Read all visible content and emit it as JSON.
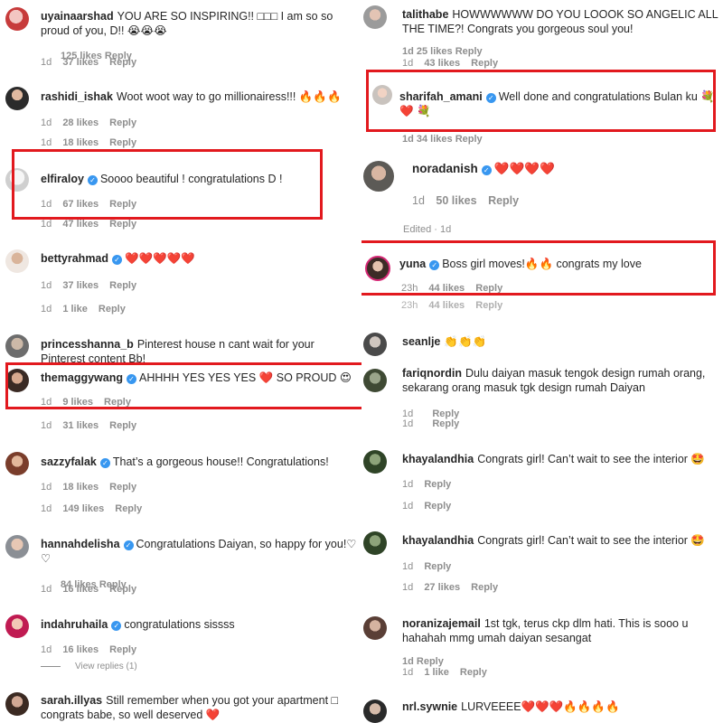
{
  "labels": {
    "likes_suffix": "likes",
    "like_suffix": "like",
    "reply": "Reply",
    "verified_mark": "✓"
  },
  "left": [
    {
      "user": "uyainaarshad",
      "verified": false,
      "text": "YOU ARE SO INSPIRING!! □□□ I am so so proud of you, D!! 😭😭😭",
      "time": "1d",
      "likes": "37 likes",
      "reply": "Reply",
      "ghost": "125 likes  Reply"
    },
    {
      "user": "rashidi_ishak",
      "verified": false,
      "text": "Woot woot way to go millionairess!!! 🔥🔥🔥",
      "time": "1d",
      "likes": "28 likes",
      "reply": "Reply",
      "ghost2_time": "1d",
      "ghost2_likes": "18 likes",
      "ghost2_reply": "Reply"
    },
    {
      "user": "elfiraloy",
      "verified": true,
      "text": "Soooo beautiful ! congratulations D !",
      "time": "1d",
      "likes": "67 likes",
      "reply": "Reply",
      "ghost2_time": "1d",
      "ghost2_likes": "47 likes",
      "ghost2_reply": "Reply"
    },
    {
      "user": "bettyrahmad",
      "verified": true,
      "text": "❤️❤️❤️❤️❤️",
      "time": "1d",
      "likes": "37 likes",
      "reply": "Reply",
      "ghost2_time": "1d",
      "ghost2_likes": "1 like",
      "ghost2_reply": "Reply"
    },
    {
      "user": "princesshanna_b",
      "verified": false,
      "text": "Pinterest house n cant wait for your Pinterest content Bb!"
    },
    {
      "user": "themaggywang",
      "verified": true,
      "text": "AHHHH YES YES YES ❤️ SO PROUD 😍",
      "time": "1d",
      "likes": "9 likes",
      "reply": "Reply",
      "ghost2_time": "1d",
      "ghost2_likes": "31 likes",
      "ghost2_reply": "Reply"
    },
    {
      "user": "sazzyfalak",
      "verified": true,
      "text": "That’s a gorgeous house!! Congratulations!",
      "time": "1d",
      "likes": "18 likes",
      "reply": "Reply",
      "ghost2_time": "1d",
      "ghost2_likes": "149 likes",
      "ghost2_reply": "Reply"
    },
    {
      "user": "hannahdelisha",
      "verified": true,
      "text": "Congratulations Daiyan, so happy for you!♡ ♡",
      "time": "1d",
      "likes": "16 likes",
      "reply": "Reply",
      "ghost": "84 likes  Reply"
    },
    {
      "user": "indahruhaila",
      "verified": true,
      "text": "congratulations sissss",
      "time": "1d",
      "likes": "16 likes",
      "reply": "Reply",
      "view_replies": "View replies (1)"
    },
    {
      "user": "sarah.illyas",
      "verified": false,
      "text": "Still remember when you got your apartment □ congrats babe, so well deserved ❤️"
    }
  ],
  "right": [
    {
      "user": "talithabe",
      "verified": false,
      "text": "HOWWWWWW DO YOU LOOOK SO ANGELIC ALL THE TIME?! Congrats you gorgeous soul you!",
      "time": "1d",
      "likes": "43 likes",
      "reply": "Reply",
      "ghost": "1d   25 likes  Reply"
    },
    {
      "user": "sharifah_amani",
      "verified": true,
      "text": "Well done and congratulations Bulan ku 💐 ❤️ 💐",
      "ghost": "1d   34 likes  Reply"
    },
    {
      "user": "noradanish",
      "verified": true,
      "text": "❤️❤️❤️❤️",
      "time": "1d",
      "likes": "50 likes",
      "reply": "Reply",
      "edited": "Edited · 1d"
    },
    {
      "user": "yuna",
      "verified": true,
      "text": "Boss girl moves!🔥🔥 congrats my love",
      "time": "23h",
      "likes": "44 likes",
      "reply": "Reply",
      "ghost2_time": "23h",
      "ghost2_likes": "44 likes",
      "ghost2_reply": "Reply"
    },
    {
      "user": "seanlje",
      "verified": false,
      "text": "👏👏👏"
    },
    {
      "user": "fariqnordin",
      "verified": false,
      "text": "Dulu daiyan masuk tengok design rumah orang, sekarang orang masuk tgk design rumah Daiyan",
      "time": "1d",
      "likes": "",
      "reply": "Reply",
      "ghost2_time": "1d",
      "ghost2_likes": "",
      "ghost2_reply": "Reply"
    },
    {
      "user": "khayalandhia",
      "verified": false,
      "text": "Congrats girl! Can’t wait to see the interior 🤩",
      "time": "1d",
      "likes": "",
      "reply": "Reply",
      "ghost2_time": "1d",
      "ghost2_likes": "",
      "ghost2_reply": "Reply"
    },
    {
      "user": "khayalandhia",
      "verified": false,
      "text": "Congrats girl! Can’t wait to see the interior 🤩",
      "time": "1d",
      "likes": "",
      "reply": "Reply",
      "ghost2_time": "1d",
      "ghost2_likes": "27 likes",
      "ghost2_reply": "Reply"
    },
    {
      "user": "noranizajemail",
      "verified": false,
      "text": "1st tgk, terus ckp dlm hati. This is sooo u hahahah mmg umah daiyan sesangat",
      "time": "1d",
      "likes": "1 like",
      "reply": "Reply",
      "ghost": "1d   Reply"
    },
    {
      "user": "nrl.sywnie",
      "verified": false,
      "text": "LURVEEEE❤️❤️❤️🔥🔥🔥🔥"
    }
  ],
  "colors": {
    "highlight": "#e2191e",
    "verified": "#3897f0",
    "muted": "#8e8e8e",
    "text": "#262626",
    "heart": "#e8232e"
  }
}
